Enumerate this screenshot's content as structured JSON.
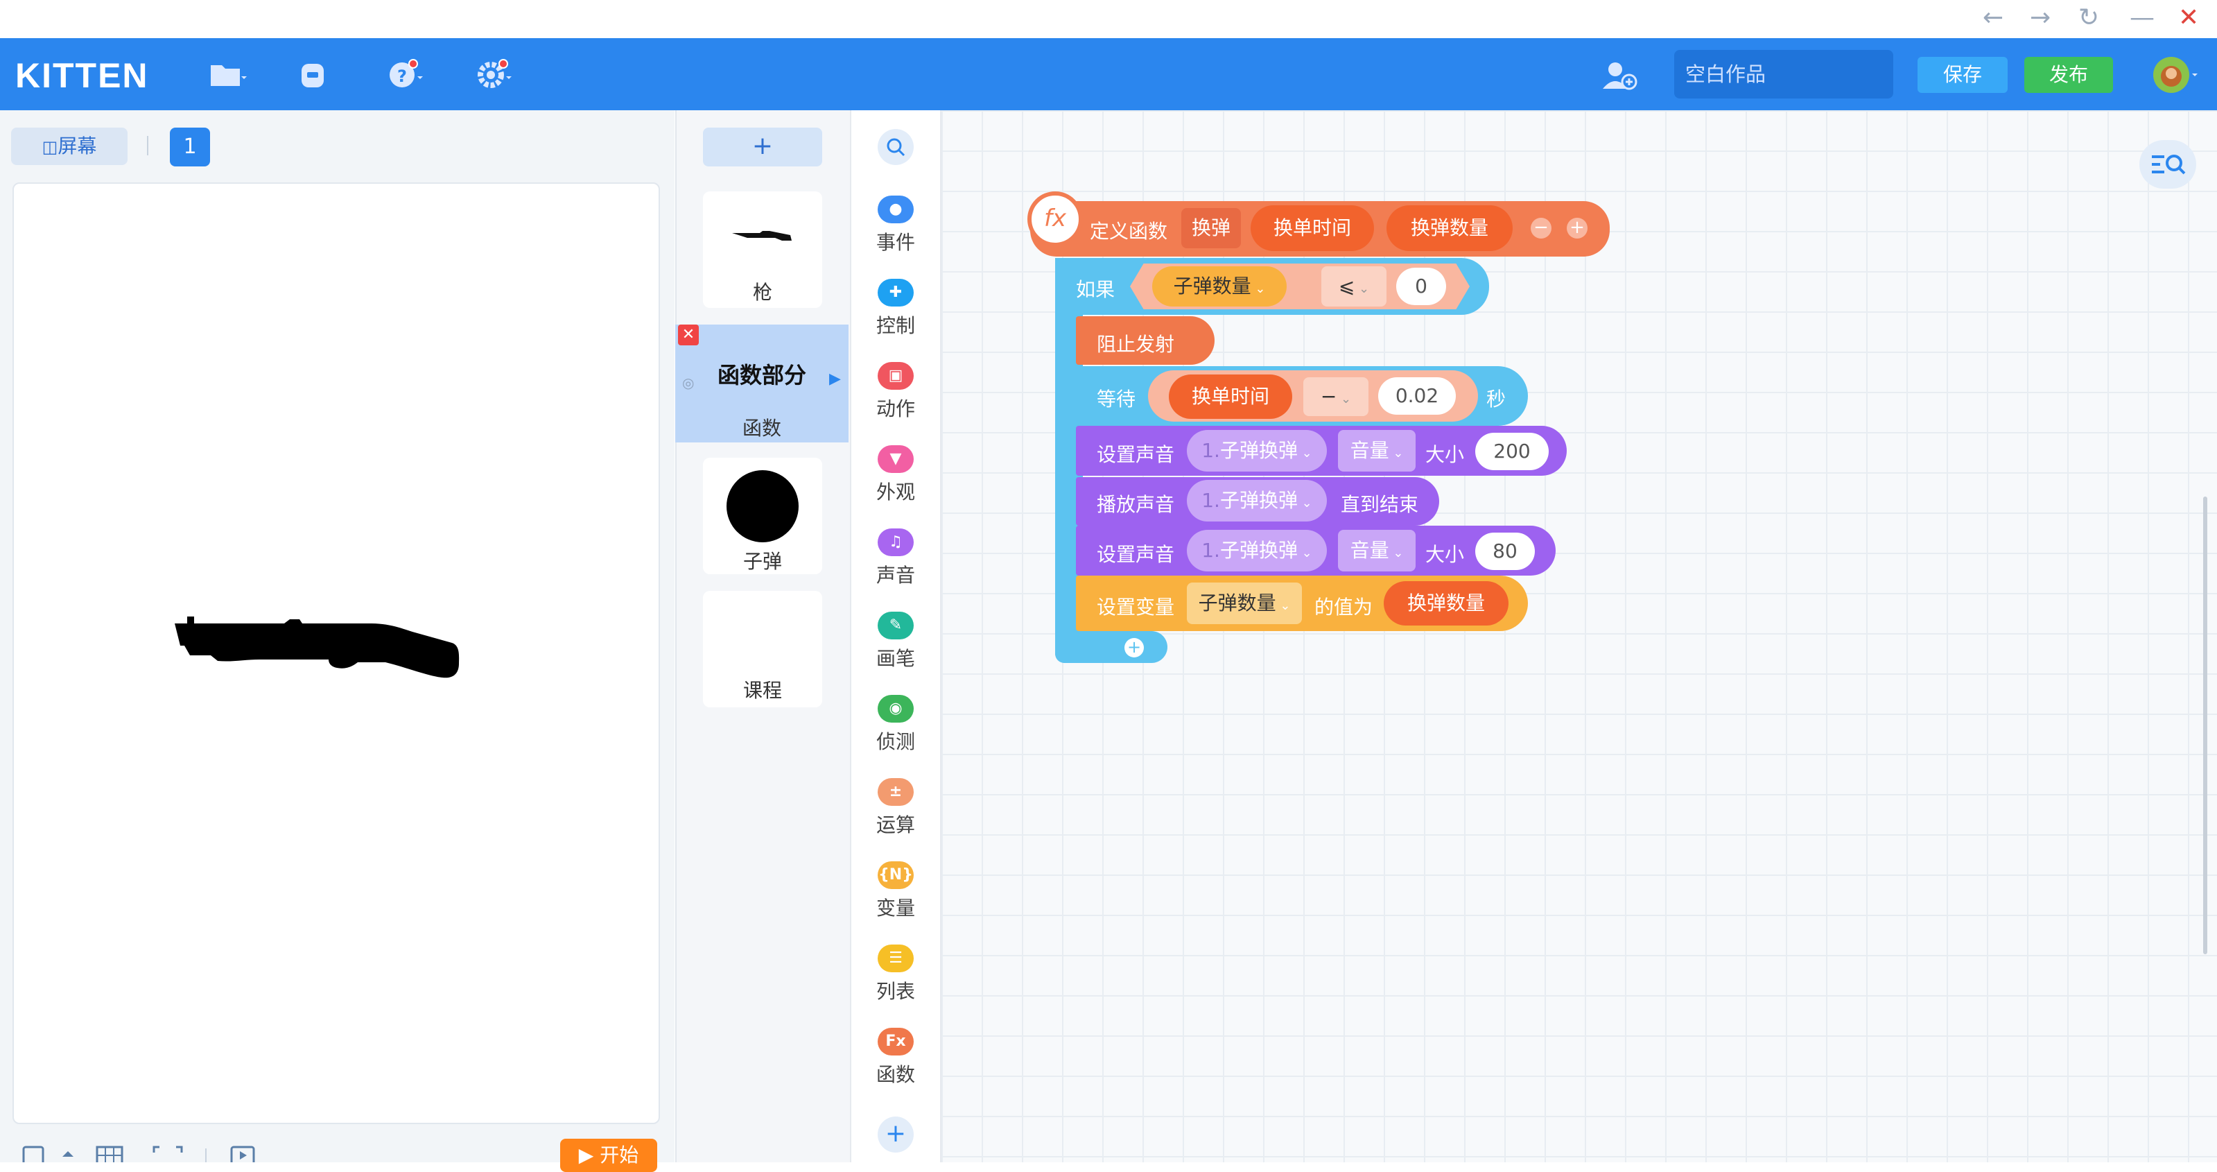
{
  "app": {
    "logo": "KITTEN"
  },
  "window_controls": {
    "back": "←",
    "forward": "→",
    "refresh": "↻",
    "minimize": "—",
    "close": "✕"
  },
  "header": {
    "work_name_placeholder": "空白作品",
    "save_label": "保存",
    "publish_label": "发布"
  },
  "stage": {
    "tab_label": "屏幕",
    "page_number": "1",
    "start_label": "开始"
  },
  "sprites": [
    {
      "name": "枪",
      "selected": false
    },
    {
      "name": "函数",
      "selected": true,
      "preview_text": "函数部分"
    },
    {
      "name": "子弹",
      "selected": false
    },
    {
      "name": "课程",
      "selected": false
    }
  ],
  "categories": [
    {
      "label": "事件",
      "color": "#3c8ef5",
      "icon": "toggle-icon"
    },
    {
      "label": "控制",
      "color": "#1ea1f2",
      "icon": "gamepad-icon"
    },
    {
      "label": "动作",
      "color": "#f0565f",
      "icon": "robot-icon"
    },
    {
      "label": "外观",
      "color": "#f25fa3",
      "icon": "shirt-icon"
    },
    {
      "label": "声音",
      "color": "#a866f0",
      "icon": "music-icon"
    },
    {
      "label": "画笔",
      "color": "#22b89a",
      "icon": "pen-icon"
    },
    {
      "label": "侦测",
      "color": "#3cb55a",
      "icon": "radar-icon"
    },
    {
      "label": "运算",
      "color": "#f39b6f",
      "icon": "math-icon"
    },
    {
      "label": "变量",
      "color": "#f7b13b",
      "icon": "variable-icon",
      "glyph": "{N}"
    },
    {
      "label": "列表",
      "color": "#f6bf26",
      "icon": "list-icon"
    },
    {
      "label": "函数",
      "color": "#f0784b",
      "icon": "function-icon",
      "glyph": "Fx"
    }
  ],
  "colors": {
    "function": "#f27d52",
    "control": "#5cc3f0",
    "sound": "#9d62f0",
    "variable": "#f9b13f",
    "brand": "#2b86ee",
    "save": "#38a8f7",
    "publish": "#3cc05b"
  },
  "script": {
    "define_label": "定义函数",
    "function_name": "换弹",
    "params": [
      "换单时间",
      "换弹数量"
    ],
    "minus": "−",
    "plus": "+",
    "if_label": "如果",
    "if_var": "子弹数量",
    "if_op": "⩽",
    "if_value": "0",
    "stop_label": "阻止发射",
    "wait_label": "等待",
    "wait_param": "换单时间",
    "wait_op": "−",
    "wait_value": "0.02",
    "wait_unit": "秒",
    "set_sound_label": "设置声音",
    "sound_name_prefix": "1.",
    "sound_name": "子弹换弹",
    "volume_label": "音量",
    "size_label": "大小",
    "volume_value_1": "200",
    "play_sound_label": "播放声音",
    "until_done_label": "直到结束",
    "volume_value_2": "80",
    "set_var_label": "设置变量",
    "set_var_name": "子弹数量",
    "set_var_to_label": "的值为",
    "set_var_value": "换弹数量",
    "add_label": "+"
  }
}
